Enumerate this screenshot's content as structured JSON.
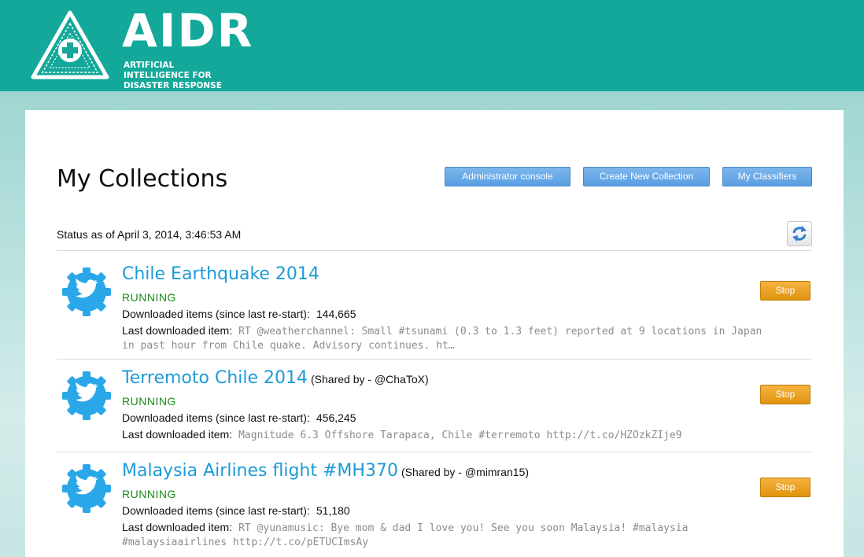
{
  "header": {
    "brand": "AIDR",
    "tagline": "ARTIFICIAL INTELLIGENCE FOR DISASTER RESPONSE",
    "colors": {
      "bar": "#13a89a",
      "link": "#1e9ad6",
      "running": "#1a8a1a",
      "stop": "#e69b17",
      "button": "#5a9ee2"
    }
  },
  "page": {
    "title": "My Collections",
    "buttons": {
      "admin": "Administrator console",
      "create": "Create New Collection",
      "classifiers": "My Classifiers"
    },
    "status": "Status as of April 3, 2014, 3:46:53 AM",
    "refresh_icon": "refresh-icon"
  },
  "collections": [
    {
      "name": "Chile Earthquake 2014",
      "shared": "",
      "state": "RUNNING",
      "downloaded_label": "Downloaded items (since last re-start):",
      "downloaded": "144,665",
      "last_label": "Last downloaded item:",
      "last_item": "RT @weatherchannel: Small #tsunami (0.3 to 1.3 feet) reported at 9 locations in Japan in past hour from Chile quake. Advisory continues. ht…",
      "stop": "Stop"
    },
    {
      "name": "Terremoto Chile 2014",
      "shared": "(Shared by - @ChaToX)",
      "state": "RUNNING",
      "downloaded_label": "Downloaded items (since last re-start):",
      "downloaded": "456,245",
      "last_label": "Last downloaded item:",
      "last_item": "Magnitude 6.3 Offshore Tarapaca, Chile #terremoto http://t.co/HZOzkZIje9",
      "stop": "Stop"
    },
    {
      "name": "Malaysia Airlines flight #MH370",
      "shared": "(Shared by - @mimran15)",
      "state": "RUNNING",
      "downloaded_label": "Downloaded items (since last re-start):",
      "downloaded": "51,180",
      "last_label": "Last downloaded item:",
      "last_item": "RT @yunamusic: Bye mom & dad I love you! See you soon Malaysia! #malaysia #malaysiaairlines http://t.co/pETUCImsAy",
      "stop": "Stop"
    }
  ]
}
